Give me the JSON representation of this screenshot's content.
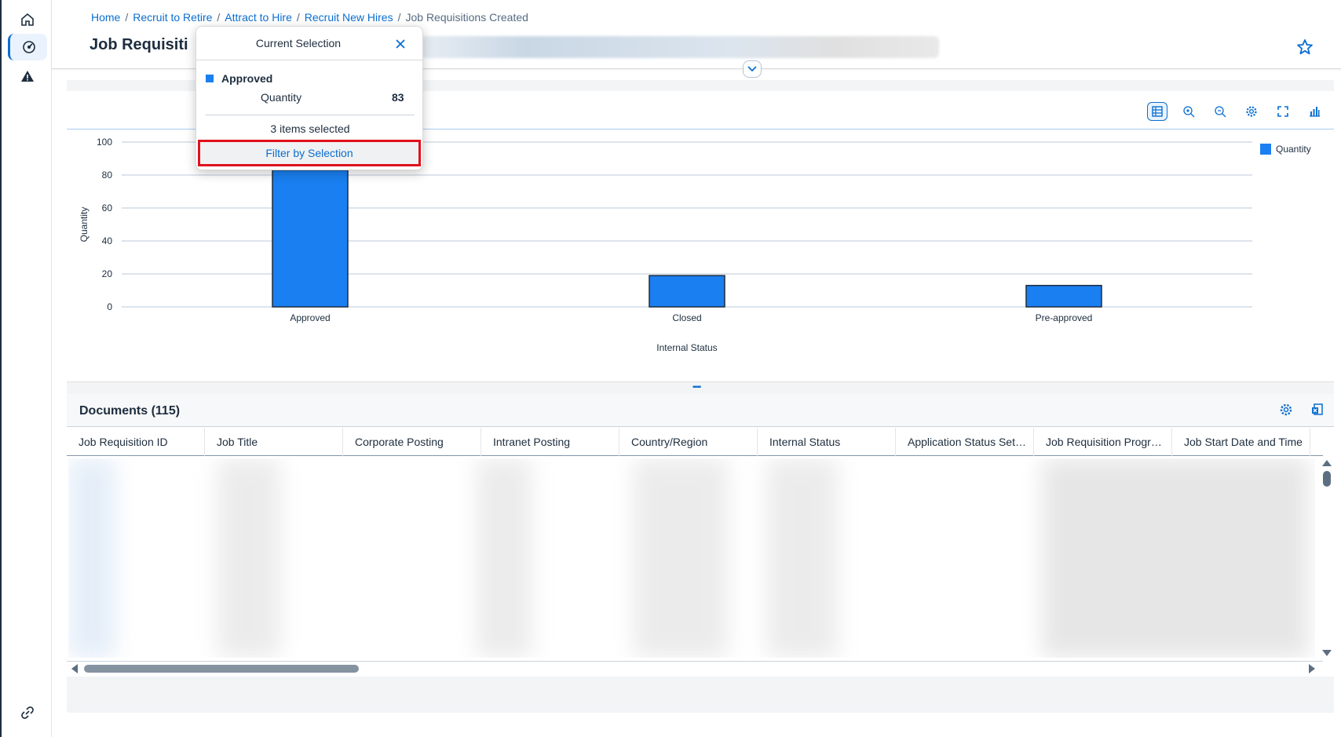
{
  "header": {
    "breadcrumb": [
      "Home",
      "Recruit to Retire",
      "Attract to Hire",
      "Recruit New Hires"
    ],
    "breadcrumb_current": "Job Requisitions Created",
    "title": "Job Requisiti"
  },
  "nav": {
    "items": [
      "home-icon",
      "dashboard-icon",
      "alert-icon",
      "link-icon"
    ]
  },
  "chart_toolbar": [
    "table-view-icon",
    "zoom-in-icon",
    "zoom-out-icon",
    "settings-icon",
    "fullscreen-icon",
    "chart-type-icon"
  ],
  "chart_data": {
    "type": "bar",
    "categories": [
      "Approved",
      "Closed",
      "Pre-approved"
    ],
    "series": [
      {
        "name": "Quantity",
        "values": [
          83,
          19,
          13
        ]
      }
    ],
    "xlabel": "Internal Status",
    "ylabel": "Quantity",
    "ylim": [
      0,
      100
    ],
    "yticks": [
      "100",
      "80",
      "60",
      "40",
      "20",
      "0"
    ],
    "grid": true,
    "legend_position": "top-right",
    "color": "#1a7ff0"
  },
  "legend": {
    "label": "Quantity"
  },
  "popover": {
    "title": "Current Selection",
    "item": "Approved",
    "measure": "Quantity",
    "value": "83",
    "count": "3 items selected",
    "filter_label": "Filter by Selection"
  },
  "documents": {
    "title": "Documents (115)",
    "columns": [
      "Job Requisition ID",
      "Job Title",
      "Corporate Posting",
      "Intranet Posting",
      "Country/Region",
      "Internal Status",
      "Application Status Set ID",
      "Job Requisition Progres...",
      "Job Start Date and Time"
    ]
  }
}
